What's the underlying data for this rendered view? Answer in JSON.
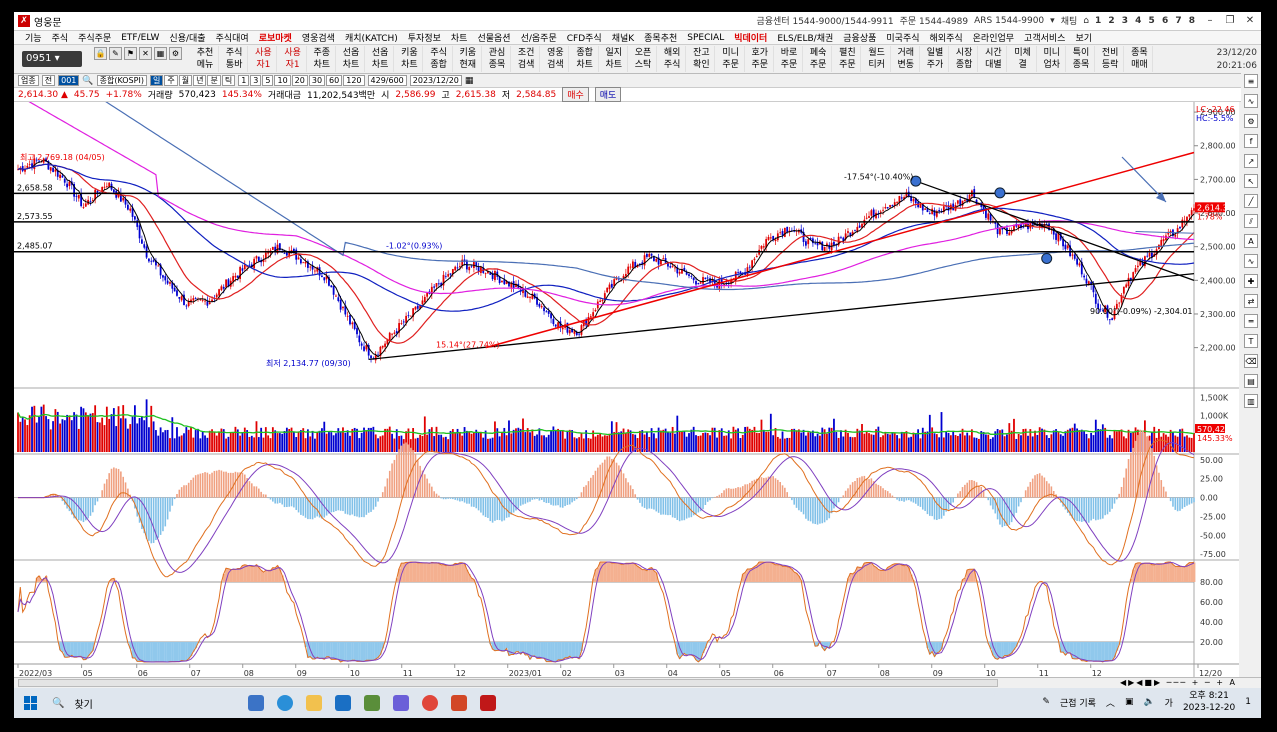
{
  "window": {
    "title": "영웅문",
    "contacts": [
      "금융센터 1544-9000/1544-9911",
      "주문 1544-4989",
      "ARS 1544-9900"
    ],
    "chat_label": "채팅",
    "screen_numbers": "1 2 3 4 5 6 7 8"
  },
  "menu": [
    "기능",
    "주식",
    "주식주문",
    "ETF/ELW",
    "신용/대출",
    "주식대여",
    "로보마켓",
    "영웅검색",
    "캐치(KATCH)",
    "투자정보",
    "차트",
    "선물옵션",
    "선/옵주문",
    "CFD주식",
    "채널K",
    "종목추천",
    "SPECIAL",
    "빅데이터",
    "ELS/ELB/채권",
    "금융상품",
    "미국주식",
    "해외주식",
    "온라인업무",
    "고객서비스",
    "보기"
  ],
  "menu_highlight": [
    "로보마켓",
    "빅데이터"
  ],
  "toolbar": {
    "screen_code": "0951",
    "buttons": [
      {
        "l1": "추천",
        "l2": "메뉴",
        "red": false
      },
      {
        "l1": "주식",
        "l2": "통바",
        "red": false
      },
      {
        "l1": "사용",
        "l2": "자1",
        "red": true
      },
      {
        "l1": "사용",
        "l2": "자1",
        "red": true
      },
      {
        "l1": "주종",
        "l2": "차트",
        "red": false
      },
      {
        "l1": "선옵",
        "l2": "차트",
        "red": false
      },
      {
        "l1": "선옵",
        "l2": "차트",
        "red": false
      },
      {
        "l1": "키움",
        "l2": "차트",
        "red": false
      },
      {
        "l1": "주식",
        "l2": "종합",
        "red": false
      },
      {
        "l1": "키움",
        "l2": "현재",
        "red": false
      },
      {
        "l1": "관심",
        "l2": "종목",
        "red": false
      },
      {
        "l1": "조건",
        "l2": "검색",
        "red": false
      },
      {
        "l1": "영웅",
        "l2": "검색",
        "red": false
      },
      {
        "l1": "종합",
        "l2": "차트",
        "red": false
      },
      {
        "l1": "일지",
        "l2": "차트",
        "red": false
      },
      {
        "l1": "오픈",
        "l2": "스탁",
        "red": false
      },
      {
        "l1": "해외",
        "l2": "주식",
        "red": false
      },
      {
        "l1": "잔고",
        "l2": "확인",
        "red": false
      },
      {
        "l1": "미니",
        "l2": "주문",
        "red": false
      },
      {
        "l1": "호가",
        "l2": "주문",
        "red": false
      },
      {
        "l1": "바로",
        "l2": "주문",
        "red": false
      },
      {
        "l1": "폐숙",
        "l2": "주문",
        "red": false
      },
      {
        "l1": "펼친",
        "l2": "주문",
        "red": false
      },
      {
        "l1": "월드",
        "l2": "티커",
        "red": false
      },
      {
        "l1": "거래",
        "l2": "변동",
        "red": false
      },
      {
        "l1": "일별",
        "l2": "주가",
        "red": false
      },
      {
        "l1": "시장",
        "l2": "종합",
        "red": false
      },
      {
        "l1": "시간",
        "l2": "대별",
        "red": false
      },
      {
        "l1": "미체",
        "l2": "결",
        "red": false
      },
      {
        "l1": "미니",
        "l2": "업차",
        "red": false
      },
      {
        "l1": "특이",
        "l2": "종목",
        "red": false
      },
      {
        "l1": "전비",
        "l2": "등락",
        "red": false
      },
      {
        "l1": "종목",
        "l2": "매매",
        "red": false
      }
    ],
    "date": "23/12/20",
    "time": "20:21:06"
  },
  "controls": {
    "category": "업종",
    "sub": "전",
    "code": "001",
    "name": "종합(KOSPI)",
    "periods": [
      "일",
      "주",
      "월",
      "년",
      "분",
      "틱"
    ],
    "active_period": "일",
    "minutes": [
      "1",
      "3",
      "5",
      "10",
      "20",
      "30",
      "60",
      "120"
    ],
    "count": "429",
    "max": "600",
    "date": "2023/12/20"
  },
  "info": {
    "price": "2,614.30",
    "change": "45.75",
    "pct": "+1.78%",
    "vol_label": "거래량",
    "volume": "570,423",
    "vol_pct": "145.34%",
    "amt_label": "거래대금",
    "amount": "11,202,543백만",
    "open_label": "시",
    "open": "2,586.99",
    "high_label": "고",
    "high": "2,615.38",
    "low_label": "저",
    "low": "2,584.85",
    "buy": "매수",
    "sell": "매도"
  },
  "chart_data": {
    "type": "line",
    "series": [
      {
        "values": [
          [
            0,
            2730
          ],
          [
            10,
            2760
          ],
          [
            20,
            2700
          ],
          [
            28,
            2620
          ],
          [
            38,
            2690
          ],
          [
            48,
            2610
          ],
          [
            55,
            2480
          ],
          [
            63,
            2400
          ],
          [
            72,
            2330
          ],
          [
            82,
            2340
          ],
          [
            92,
            2410
          ],
          [
            102,
            2460
          ],
          [
            112,
            2500
          ],
          [
            122,
            2460
          ],
          [
            132,
            2410
          ],
          [
            140,
            2300
          ],
          [
            147,
            2210
          ],
          [
            152,
            2175
          ],
          [
            160,
            2240
          ],
          [
            170,
            2310
          ],
          [
            180,
            2390
          ],
          [
            190,
            2450
          ],
          [
            200,
            2430
          ],
          [
            210,
            2390
          ],
          [
            222,
            2340
          ],
          [
            232,
            2260
          ],
          [
            240,
            2250
          ],
          [
            250,
            2350
          ],
          [
            260,
            2430
          ],
          [
            270,
            2470
          ],
          [
            280,
            2440
          ],
          [
            290,
            2400
          ],
          [
            300,
            2390
          ],
          [
            310,
            2420
          ],
          [
            320,
            2520
          ],
          [
            330,
            2560
          ],
          [
            340,
            2500
          ],
          [
            350,
            2510
          ],
          [
            360,
            2570
          ],
          [
            370,
            2620
          ],
          [
            380,
            2650
          ],
          [
            390,
            2600
          ],
          [
            400,
            2620
          ],
          [
            408,
            2660
          ],
          [
            414,
            2600
          ],
          [
            420,
            2540
          ],
          [
            430,
            2560
          ],
          [
            440,
            2570
          ],
          [
            448,
            2500
          ],
          [
            456,
            2420
          ],
          [
            462,
            2330
          ],
          [
            468,
            2290
          ],
          [
            474,
            2400
          ],
          [
            482,
            2460
          ],
          [
            490,
            2520
          ],
          [
            496,
            2550
          ],
          [
            502,
            2614.3
          ]
        ]
      }
    ],
    "volume_bars_note": "",
    "y_ticks": [
      "2,900.00",
      "2,800.00",
      "2,700.00",
      "2,600.00",
      "2,500.00",
      "2,400.00",
      "2,300.00",
      "2,200.00"
    ],
    "volume_ticks": [
      "1,500K",
      "1,000K"
    ],
    "macd_ticks": [
      "50.00",
      "25.00",
      "0.00",
      "-25.00",
      "-50.00",
      "-75.00"
    ],
    "stoch_ticks": [
      "80.00",
      "60.00",
      "40.00",
      "20.00"
    ],
    "x_labels": [
      "2022/03",
      "05",
      "06",
      "07",
      "08",
      "09",
      "10",
      "11",
      "12",
      "2023/01",
      "02",
      "03",
      "04",
      "05",
      "06",
      "07",
      "08",
      "09",
      "10",
      "11",
      "12",
      "12/20"
    ],
    "hlines": [
      "2,658.58",
      "2,573.55",
      "2,485.07"
    ],
    "annotations": {
      "high": "최고 2,769.18 (04/05)",
      "low": "최저 2,134.77 (09/30)",
      "t1": "-17.54°(-10.40%)",
      "t2": "15.14°(27.74%)",
      "t3": "90.00°(-0.09%) -2,304.01",
      "t4": "-1.02°(0.93%)",
      "lc": "LC:-22.46",
      "hc": "HC:-5.5%",
      "last": "2,614.30",
      "last_pct": "1.78%",
      "vol_last": "570,423",
      "vol_last_pct": "145.33%"
    }
  },
  "taskbar": {
    "search": "찾기",
    "tray_text": "근접 기록",
    "ime": "가",
    "time": "오후 8:21",
    "date": "2023-12-20",
    "notif": "1"
  },
  "colors": {
    "up": "#e00000",
    "down": "#0000d0",
    "ma_red": "#e02020",
    "ma_blue": "#1020c0",
    "ma_magenta": "#e020e0",
    "ma_steel": "#4a6fb5"
  }
}
